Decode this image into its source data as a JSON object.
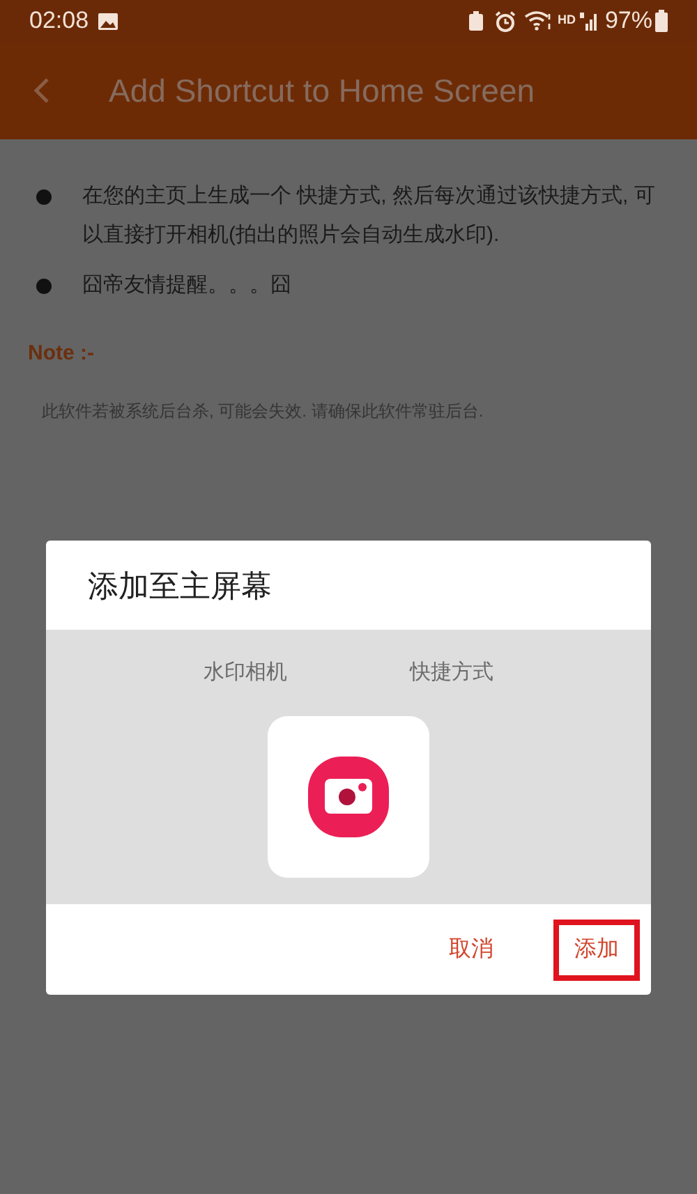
{
  "status_bar": {
    "time": "02:08",
    "battery": "97%",
    "network": "HD"
  },
  "app_bar": {
    "title": "Add Shortcut to Home Screen"
  },
  "bullets": [
    "在您的主页上生成一个 快捷方式, 然后每次通过该快捷方式, 可以直接打开相机(拍出的照片会自动生成水印).",
    "囧帝友情提醒。。。囧"
  ],
  "note": {
    "heading": "Note :-",
    "text": "此软件若被系统后台杀, 可能会失效. 请确保此软件常驻后台."
  },
  "dialog": {
    "title": "添加至主屏幕",
    "app_name": "水印相机",
    "shortcut_label": "快捷方式",
    "buttons": [
      {
        "label": "取消",
        "highlighted": false
      },
      {
        "label": "添加",
        "highlighted": true
      }
    ]
  }
}
